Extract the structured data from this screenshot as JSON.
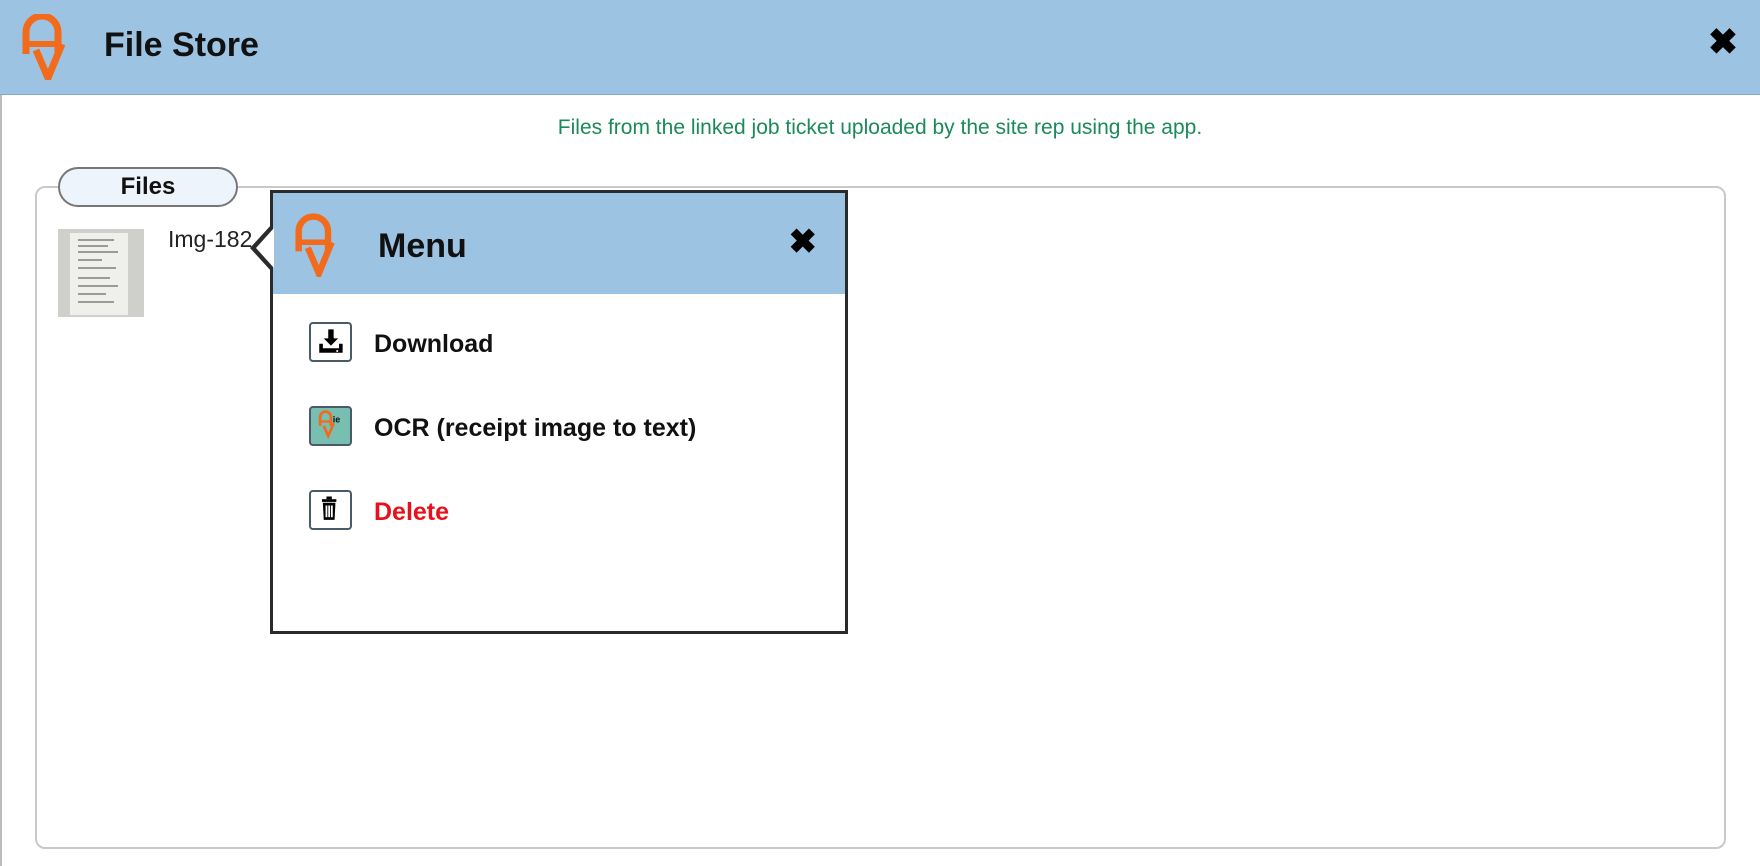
{
  "header": {
    "title": "File Store",
    "close_icon": "close-icon"
  },
  "subtitle": "Files from the linked job ticket uploaded by the site rep using the app.",
  "files": {
    "legend": "Files",
    "items": [
      {
        "name": "Img-182",
        "thumbnail": "receipt-thumbnail"
      }
    ]
  },
  "menu": {
    "title": "Menu",
    "items": [
      {
        "label": "Download",
        "icon": "download-icon"
      },
      {
        "label": "OCR (receipt image to text)",
        "icon": "ocr-icon"
      },
      {
        "label": "Delete",
        "icon": "trash-icon"
      }
    ]
  },
  "colors": {
    "header_bg": "#9dc3e3",
    "logo_orange": "#f26a1b",
    "subtitle_green": "#1b8a5a",
    "delete_red": "#e8101a",
    "ocr_icon_bg": "#78bfb2"
  }
}
